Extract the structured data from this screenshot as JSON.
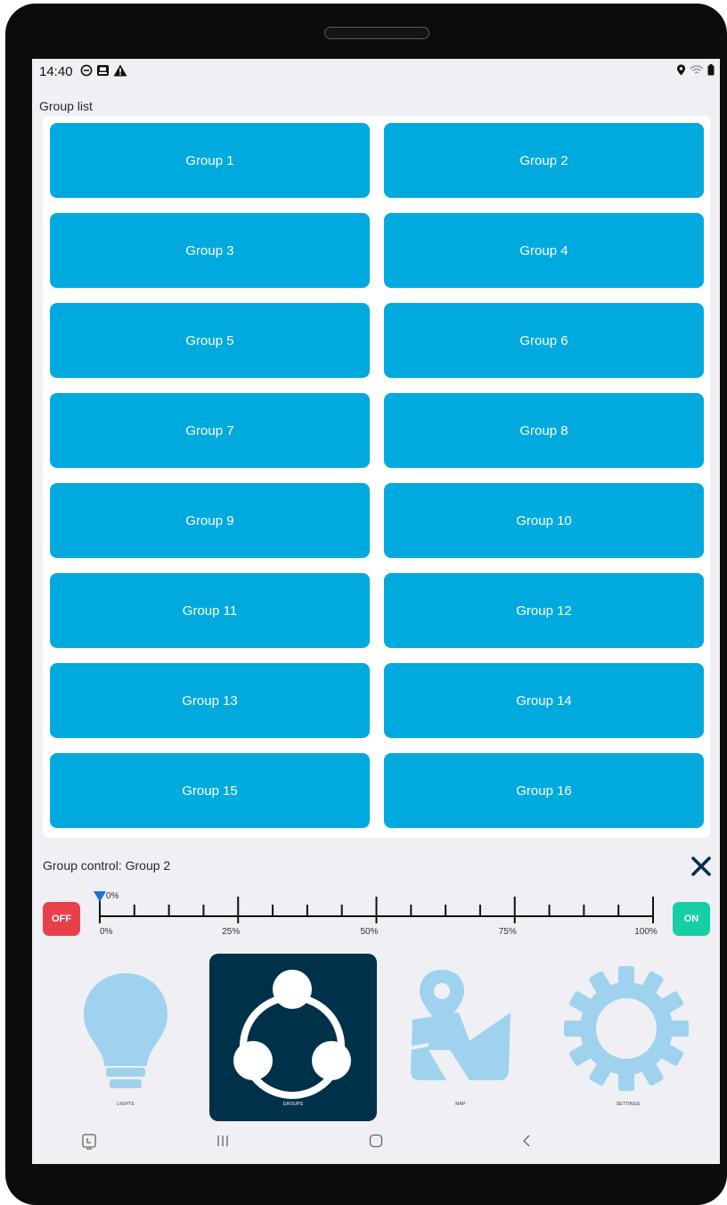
{
  "status": {
    "time": "14:40"
  },
  "group_list": {
    "title": "Group list",
    "groups": [
      "Group 1",
      "Group 2",
      "Group 3",
      "Group 4",
      "Group 5",
      "Group 6",
      "Group 7",
      "Group 8",
      "Group 9",
      "Group 10",
      "Group 11",
      "Group 12",
      "Group 13",
      "Group 14",
      "Group 15",
      "Group 16"
    ]
  },
  "control": {
    "title": "Group control: Group 2",
    "off_label": "OFF",
    "on_label": "ON",
    "value_label": "0%",
    "value": 0,
    "ticks": [
      "0%",
      "25%",
      "50%",
      "75%",
      "100%"
    ]
  },
  "nav": {
    "lights": "LIGHTS",
    "groups": "GROUPS",
    "map": "MAP",
    "settings": "SETTINGS"
  },
  "colors": {
    "group_button": "#00aade",
    "off": "#e8404b",
    "on": "#14d0a4",
    "active_nav": "#00314a",
    "nav_icon": "#9ed2ee"
  },
  "icons": [
    "do-not-disturb-icon",
    "screenshot-icon",
    "warning-icon",
    "location-icon",
    "wifi-icon",
    "battery-icon",
    "close-icon",
    "lightbulb-icon",
    "share-network-icon",
    "map-icon",
    "gear-icon",
    "recent-apps-icon",
    "home-icon",
    "back-icon",
    "keyboard-icon"
  ]
}
